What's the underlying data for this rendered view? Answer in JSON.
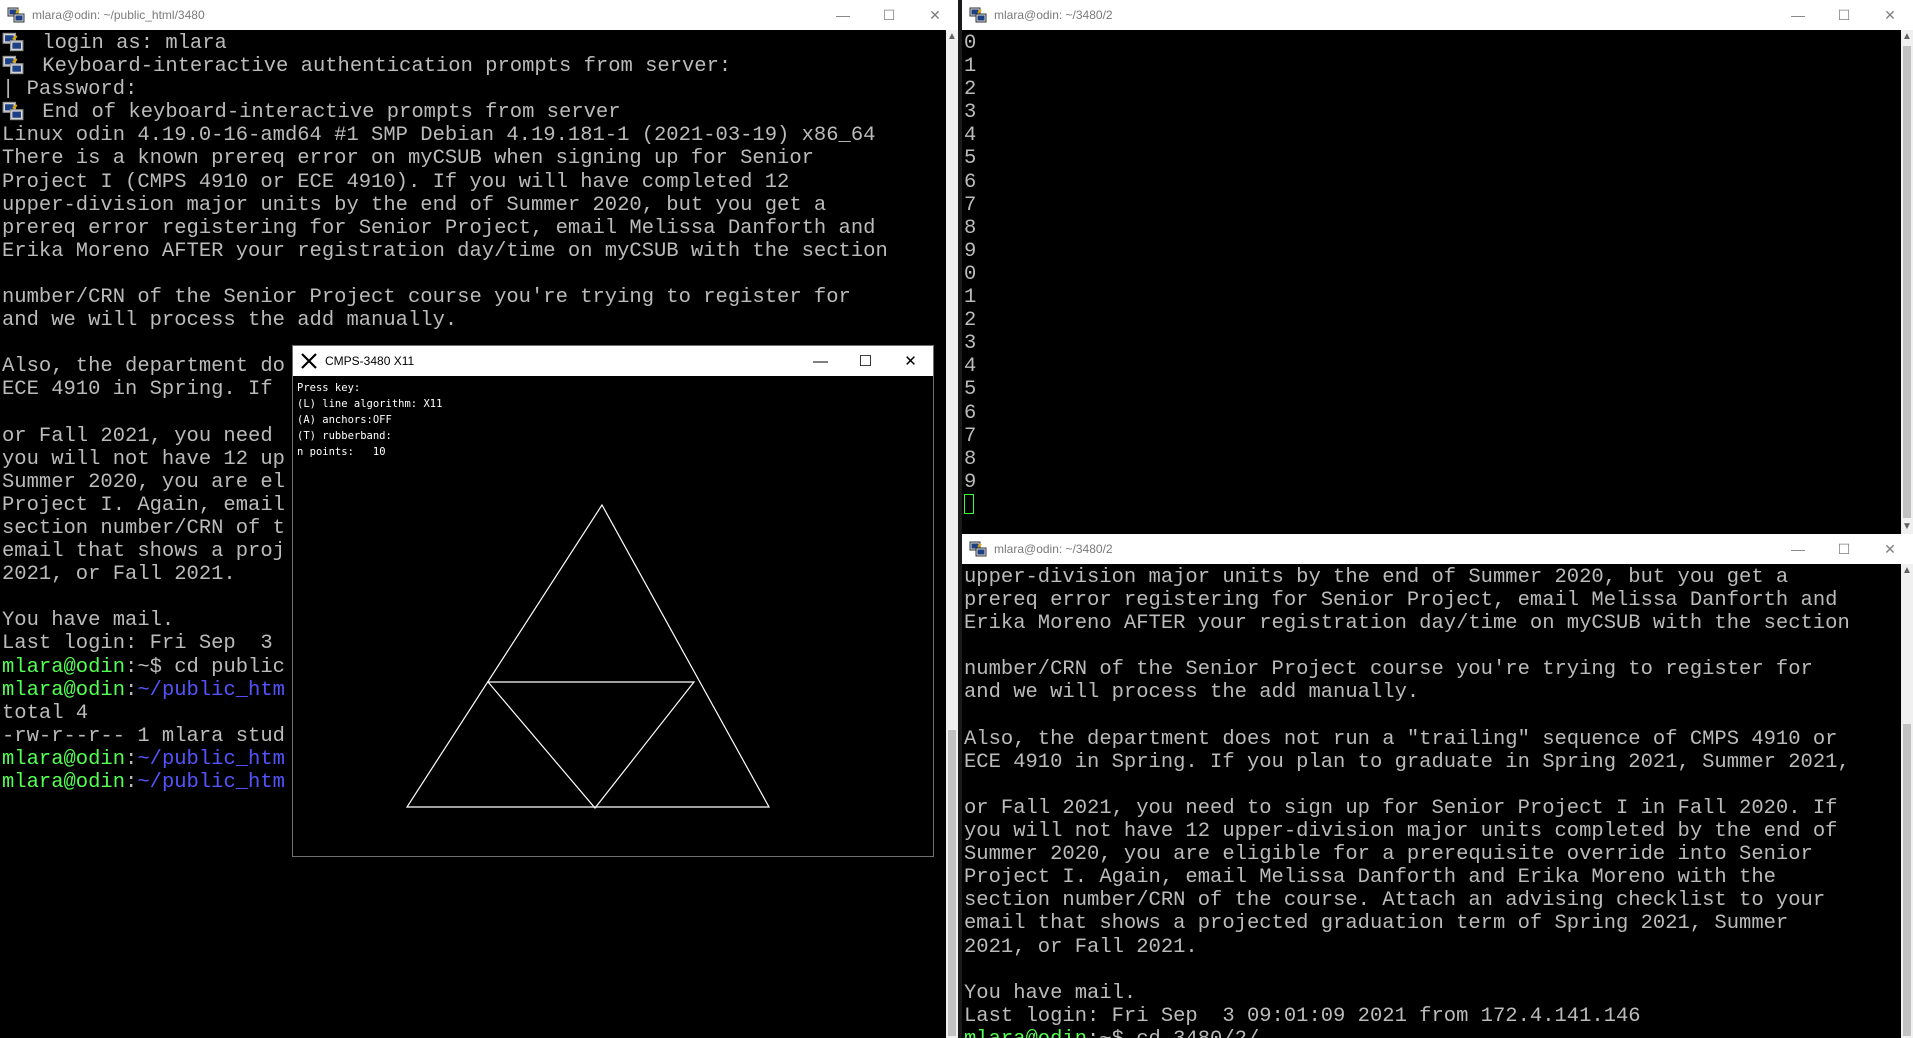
{
  "window_left": {
    "title": "mlara@odin: ~/public_html/3480",
    "lines": [
      {
        "icon": true,
        "segs": [
          {
            "c": "w",
            "t": " login as: mlara"
          }
        ]
      },
      {
        "icon": true,
        "segs": [
          {
            "c": "w",
            "t": " Keyboard-interactive authentication prompts from server:"
          }
        ]
      },
      {
        "icon": false,
        "segs": [
          {
            "c": "w",
            "t": "| Password:"
          }
        ]
      },
      {
        "icon": true,
        "segs": [
          {
            "c": "w",
            "t": " End of keyboard-interactive prompts from server"
          }
        ]
      },
      {
        "icon": false,
        "segs": [
          {
            "c": "w",
            "t": "Linux odin 4.19.0-16-amd64 #1 SMP Debian 4.19.181-1 (2021-03-19) x86_64"
          }
        ]
      },
      {
        "icon": false,
        "segs": [
          {
            "c": "w",
            "t": "There is a known prereq error on myCSUB when signing up for Senior"
          }
        ]
      },
      {
        "icon": false,
        "segs": [
          {
            "c": "w",
            "t": "Project I (CMPS 4910 or ECE 4910). If you will have completed 12"
          }
        ]
      },
      {
        "icon": false,
        "segs": [
          {
            "c": "w",
            "t": "upper-division major units by the end of Summer 2020, but you get a"
          }
        ]
      },
      {
        "icon": false,
        "segs": [
          {
            "c": "w",
            "t": "prereq error registering for Senior Project, email Melissa Danforth and"
          }
        ]
      },
      {
        "icon": false,
        "segs": [
          {
            "c": "w",
            "t": "Erika Moreno AFTER your registration day/time on myCSUB with the section"
          }
        ]
      },
      {
        "icon": false,
        "segs": [
          {
            "c": "w",
            "t": ""
          }
        ]
      },
      {
        "icon": false,
        "segs": [
          {
            "c": "w",
            "t": "number/CRN of the Senior Project course you're trying to register for"
          }
        ]
      },
      {
        "icon": false,
        "segs": [
          {
            "c": "w",
            "t": "and we will process the add manually."
          }
        ]
      },
      {
        "icon": false,
        "segs": [
          {
            "c": "w",
            "t": ""
          }
        ]
      },
      {
        "icon": false,
        "segs": [
          {
            "c": "w",
            "t": "Also, the department do"
          }
        ]
      },
      {
        "icon": false,
        "segs": [
          {
            "c": "w",
            "t": "ECE 4910 in Spring. If"
          }
        ]
      },
      {
        "icon": false,
        "segs": [
          {
            "c": "w",
            "t": ""
          }
        ]
      },
      {
        "icon": false,
        "segs": [
          {
            "c": "w",
            "t": "or Fall 2021, you need"
          }
        ]
      },
      {
        "icon": false,
        "segs": [
          {
            "c": "w",
            "t": "you will not have 12 up"
          }
        ]
      },
      {
        "icon": false,
        "segs": [
          {
            "c": "w",
            "t": "Summer 2020, you are el"
          }
        ]
      },
      {
        "icon": false,
        "segs": [
          {
            "c": "w",
            "t": "Project I. Again, email"
          }
        ]
      },
      {
        "icon": false,
        "segs": [
          {
            "c": "w",
            "t": "section number/CRN of t"
          }
        ]
      },
      {
        "icon": false,
        "segs": [
          {
            "c": "w",
            "t": "email that shows a proj"
          }
        ]
      },
      {
        "icon": false,
        "segs": [
          {
            "c": "w",
            "t": "2021, or Fall 2021."
          }
        ]
      },
      {
        "icon": false,
        "segs": [
          {
            "c": "w",
            "t": ""
          }
        ]
      },
      {
        "icon": false,
        "segs": [
          {
            "c": "w",
            "t": "You have mail."
          }
        ]
      },
      {
        "icon": false,
        "segs": [
          {
            "c": "w",
            "t": "Last login: Fri Sep  3"
          }
        ]
      },
      {
        "icon": false,
        "segs": [
          {
            "c": "g",
            "t": "mlara@odin"
          },
          {
            "c": "w",
            "t": ":~$ cd public"
          }
        ]
      },
      {
        "icon": false,
        "segs": [
          {
            "c": "g",
            "t": "mlara@odin"
          },
          {
            "c": "w",
            "t": ":"
          },
          {
            "c": "b",
            "t": "~/public_htm"
          }
        ]
      },
      {
        "icon": false,
        "segs": [
          {
            "c": "w",
            "t": "total 4"
          }
        ]
      },
      {
        "icon": false,
        "segs": [
          {
            "c": "w",
            "t": "-rw-r--r-- 1 mlara stud"
          }
        ]
      },
      {
        "icon": false,
        "segs": [
          {
            "c": "g",
            "t": "mlara@odin"
          },
          {
            "c": "w",
            "t": ":"
          },
          {
            "c": "b",
            "t": "~/public_htm"
          }
        ]
      },
      {
        "icon": false,
        "segs": [
          {
            "c": "g",
            "t": "mlara@odin"
          },
          {
            "c": "w",
            "t": ":"
          },
          {
            "c": "b",
            "t": "~/public_htm"
          }
        ]
      }
    ]
  },
  "window_top_right": {
    "title": "mlara@odin: ~/3480/2",
    "lines": [
      "0",
      "1",
      "2",
      "3",
      "4",
      "5",
      "6",
      "7",
      "8",
      "9",
      "0",
      "1",
      "2",
      "3",
      "4",
      "5",
      "6",
      "7",
      "8",
      "9"
    ]
  },
  "window_bottom_right": {
    "title": "mlara@odin: ~/3480/2",
    "lines": [
      {
        "segs": [
          {
            "c": "w",
            "t": "upper-division major units by the end of Summer 2020, but you get a"
          }
        ]
      },
      {
        "segs": [
          {
            "c": "w",
            "t": "prereq error registering for Senior Project, email Melissa Danforth and"
          }
        ]
      },
      {
        "segs": [
          {
            "c": "w",
            "t": "Erika Moreno AFTER your registration day/time on myCSUB with the section"
          }
        ]
      },
      {
        "segs": [
          {
            "c": "w",
            "t": ""
          }
        ]
      },
      {
        "segs": [
          {
            "c": "w",
            "t": "number/CRN of the Senior Project course you're trying to register for"
          }
        ]
      },
      {
        "segs": [
          {
            "c": "w",
            "t": "and we will process the add manually."
          }
        ]
      },
      {
        "segs": [
          {
            "c": "w",
            "t": ""
          }
        ]
      },
      {
        "segs": [
          {
            "c": "w",
            "t": "Also, the department does not run a \"trailing\" sequence of CMPS 4910 or"
          }
        ]
      },
      {
        "segs": [
          {
            "c": "w",
            "t": "ECE 4910 in Spring. If you plan to graduate in Spring 2021, Summer 2021,"
          }
        ]
      },
      {
        "segs": [
          {
            "c": "w",
            "t": ""
          }
        ]
      },
      {
        "segs": [
          {
            "c": "w",
            "t": "or Fall 2021, you need to sign up for Senior Project I in Fall 2020. If"
          }
        ]
      },
      {
        "segs": [
          {
            "c": "w",
            "t": "you will not have 12 upper-division major units completed by the end of"
          }
        ]
      },
      {
        "segs": [
          {
            "c": "w",
            "t": "Summer 2020, you are eligible for a prerequisite override into Senior"
          }
        ]
      },
      {
        "segs": [
          {
            "c": "w",
            "t": "Project I. Again, email Melissa Danforth and Erika Moreno with the"
          }
        ]
      },
      {
        "segs": [
          {
            "c": "w",
            "t": "section number/CRN of the course. Attach an advising checklist to your"
          }
        ]
      },
      {
        "segs": [
          {
            "c": "w",
            "t": "email that shows a projected graduation term of Spring 2021, Summer"
          }
        ]
      },
      {
        "segs": [
          {
            "c": "w",
            "t": "2021, or Fall 2021."
          }
        ]
      },
      {
        "segs": [
          {
            "c": "w",
            "t": ""
          }
        ]
      },
      {
        "segs": [
          {
            "c": "w",
            "t": "You have mail."
          }
        ]
      },
      {
        "segs": [
          {
            "c": "w",
            "t": "Last login: Fri Sep  3 09:01:09 2021 from 172.4.141.146"
          }
        ]
      },
      {
        "segs": [
          {
            "c": "g",
            "t": "mlara@odin"
          },
          {
            "c": "w",
            "t": ":~$ cd 3480/2/"
          }
        ]
      }
    ]
  },
  "x11_window": {
    "title": "CMPS-3480 X11",
    "press_key": "Press key:",
    "line_algorithm_label": "(L) line algorithm:",
    "line_algorithm_value": "X11",
    "anchors_label": "(A) anchors:",
    "anchors_value": "OFF",
    "rubberband_label": "(T) rubberband:",
    "rubberband_value": "",
    "n_points_label": "n points:",
    "n_points_value": "10"
  },
  "window_controls": {
    "minimize": "—",
    "maximize": "☐",
    "close": "✕"
  },
  "colors": {
    "prompt_user": "#54ff54",
    "prompt_path": "#5454ff",
    "text": "#bbbbbb",
    "cursor": "#33ff33"
  }
}
